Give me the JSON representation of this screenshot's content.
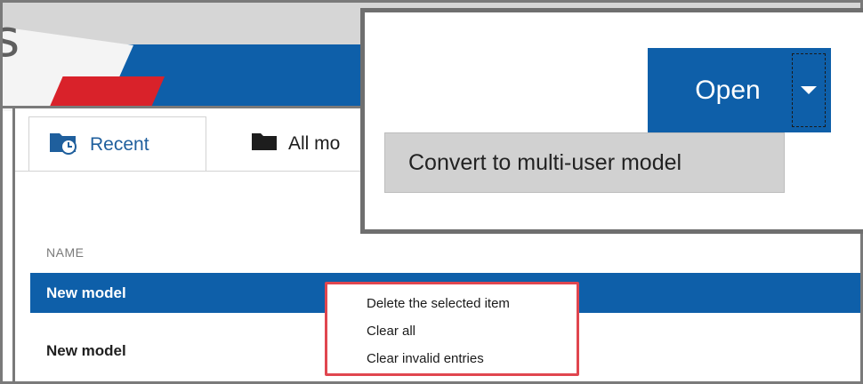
{
  "header": {
    "partial_title": "s"
  },
  "tabs": [
    {
      "label": "Recent",
      "icon": "folder-clock-icon"
    },
    {
      "label": "All mo",
      "icon": "folder-icon"
    }
  ],
  "table": {
    "column_header": "NAME",
    "rows": [
      {
        "name": "New model",
        "selected": true
      },
      {
        "name": "New model",
        "selected": false
      }
    ]
  },
  "context_menu": {
    "items": [
      "Delete the selected item",
      "Clear all",
      "Clear invalid entries"
    ],
    "highlight_color": "#e0464f"
  },
  "open_split_button": {
    "label": "Open",
    "dropdown_icon": "caret-down-icon",
    "menu_items": [
      "Convert to multi-user model"
    ]
  },
  "colors": {
    "accent": "#0e5fa9",
    "brand_red": "#d9222a",
    "frame": "#7a7a7a"
  }
}
